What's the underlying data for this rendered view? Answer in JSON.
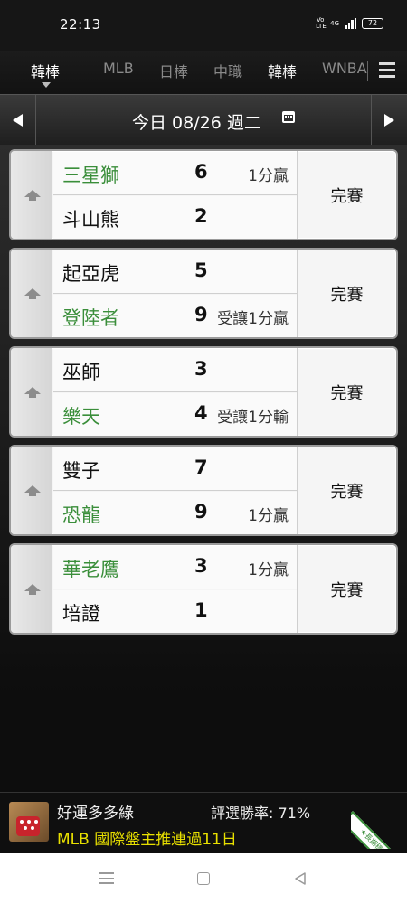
{
  "status_bar": {
    "time": "22:13",
    "volte": "Vo LTE",
    "network": "4G",
    "battery": "72"
  },
  "nav": {
    "tabs": [
      {
        "label": "韓棒",
        "active": true
      },
      {
        "label": "MLB"
      },
      {
        "label": "日棒"
      },
      {
        "label": "中職"
      },
      {
        "label": "韓棒"
      },
      {
        "label": "WNBA"
      }
    ],
    "menu_icon": "hamburger-menu-icon"
  },
  "date_bar": {
    "label": "今日 08/26 週二",
    "prev_icon": "triangle-left-icon",
    "next_icon": "triangle-right-icon",
    "calendar_icon": "calendar-icon"
  },
  "games": [
    {
      "home": {
        "name": "三星獅",
        "score": "6",
        "note": "1分贏",
        "winner": true
      },
      "away": {
        "name": "斗山熊",
        "score": "2",
        "note": "",
        "winner": false
      },
      "status": "完賽"
    },
    {
      "home": {
        "name": "起亞虎",
        "score": "5",
        "note": "",
        "winner": false
      },
      "away": {
        "name": "登陸者",
        "score": "9",
        "note": "受讓1分贏",
        "winner": true
      },
      "status": "完賽"
    },
    {
      "home": {
        "name": "巫師",
        "score": "3",
        "note": "",
        "winner": false
      },
      "away": {
        "name": "樂天",
        "score": "4",
        "note": "受讓1分輸",
        "winner": true
      },
      "status": "完賽"
    },
    {
      "home": {
        "name": "雙子",
        "score": "7",
        "note": "",
        "winner": false
      },
      "away": {
        "name": "恐龍",
        "score": "9",
        "note": "1分贏",
        "winner": true
      },
      "status": "完賽"
    },
    {
      "home": {
        "name": "華老鷹",
        "score": "3",
        "note": "1分贏",
        "winner": true
      },
      "away": {
        "name": "培證",
        "score": "1",
        "note": "",
        "winner": false
      },
      "status": "完賽"
    }
  ],
  "promo": {
    "name": "好運多多綠",
    "rate": "評選勝率: 71%",
    "headline": "MLB 國際盤主推連過11日",
    "ribbon": "★長期穩定★"
  },
  "colors": {
    "winner_green": "#3a8e3a",
    "promo_yellow": "#e8e000"
  }
}
